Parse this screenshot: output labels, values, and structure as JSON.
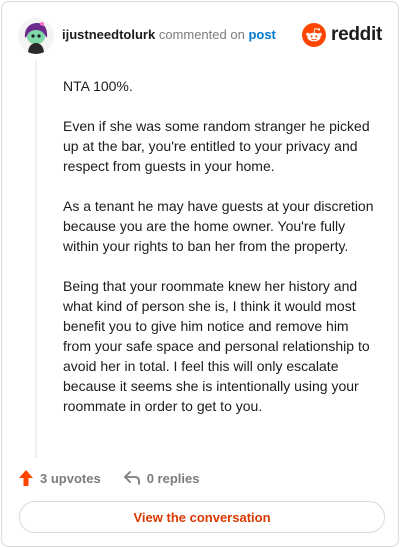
{
  "comment": {
    "username": "ijustneedtolurk",
    "commented_text": "commented on",
    "post_link": "post",
    "paragraphs": [
      "NTA 100%.",
      "Even if she was some random stranger he picked up at the bar, you're entitled to your privacy and respect from guests in your home.",
      "As a tenant he may have guests at your discretion because you are the home owner. You're fully within your rights to ban her from the property.",
      "Being that your roommate knew her history and what kind of person she is, I think it would most benefit you to give him notice and remove him from your safe space and personal relationship to avoid her in total. I feel this will only escalate because it seems she is intentionally using your roommate in order to get to you."
    ]
  },
  "brand": {
    "name": "reddit",
    "icon": "reddit-logo-icon",
    "color": "#ff4500"
  },
  "actions": {
    "upvotes": "3 upvotes",
    "replies": "0 replies"
  },
  "cta": {
    "label": "View the conversation"
  },
  "colors": {
    "accent": "#d93a00",
    "link": "#0079d3",
    "upvote": "#ff4500",
    "muted": "#7c7c7c"
  }
}
